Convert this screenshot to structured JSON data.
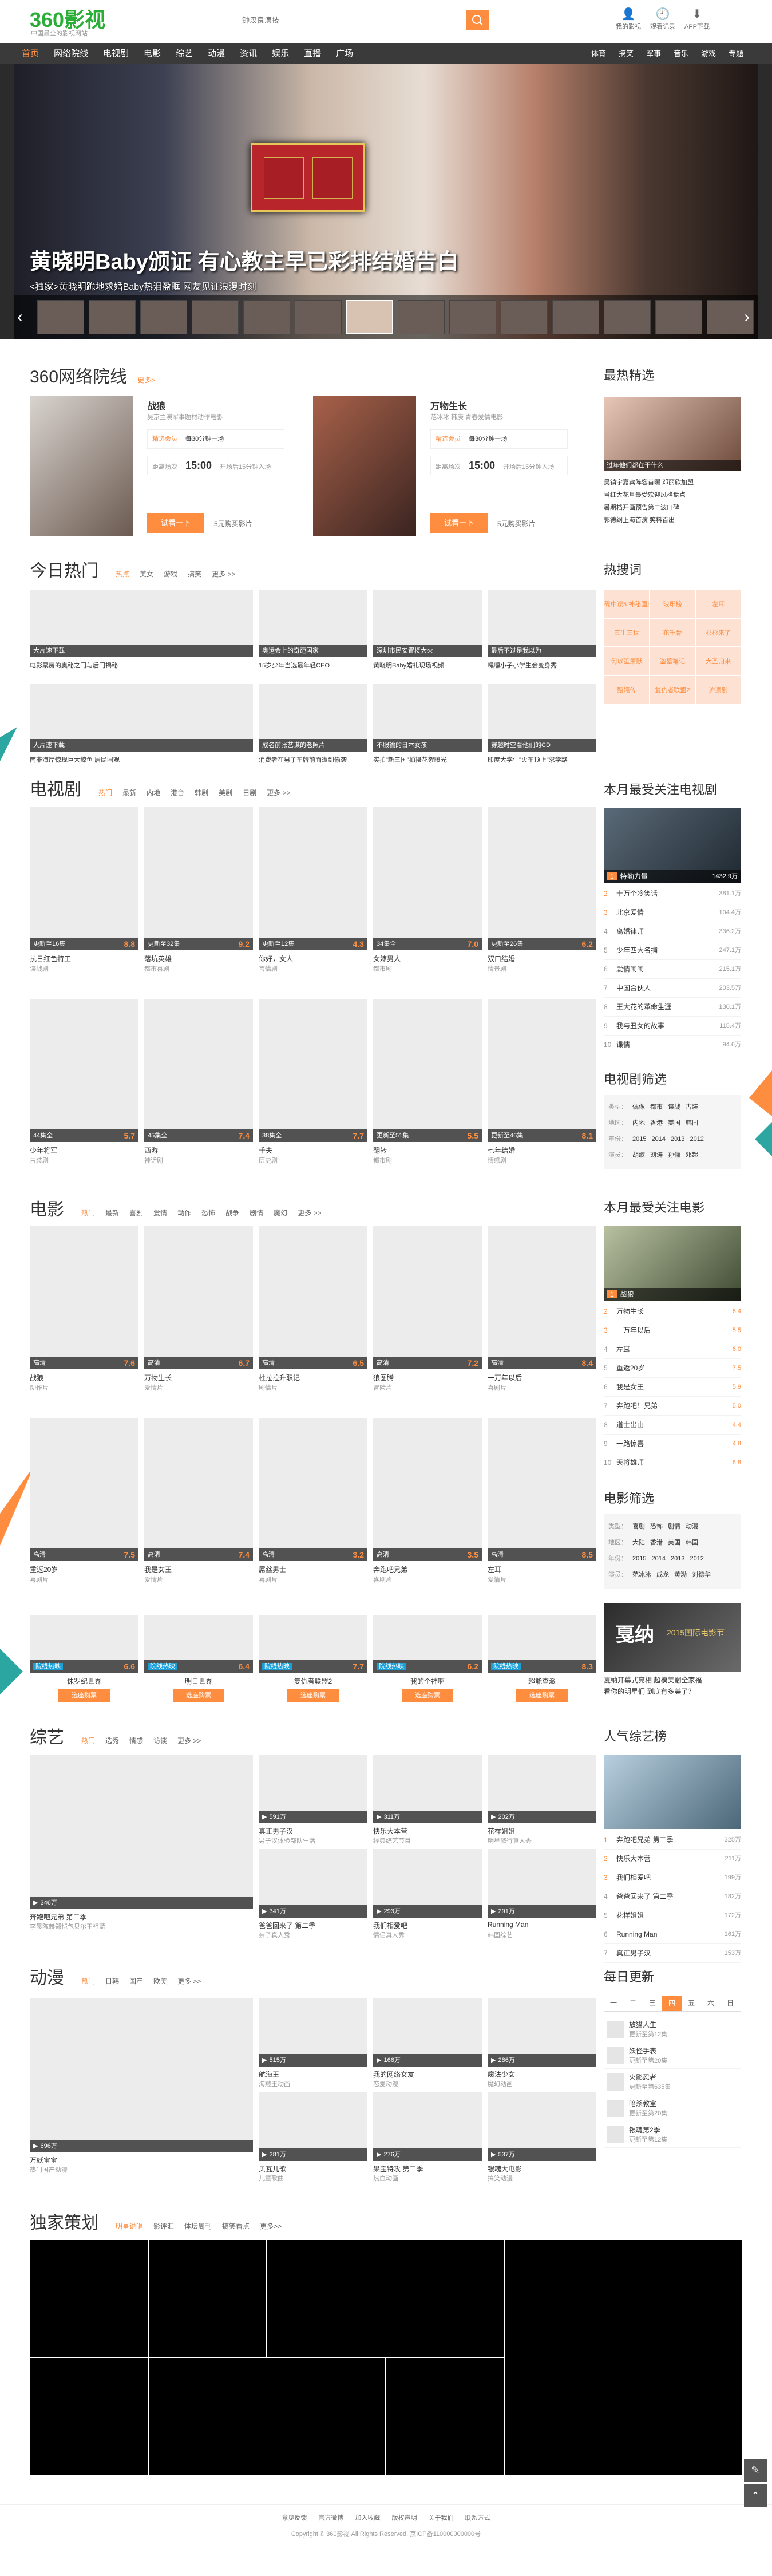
{
  "header": {
    "logo_text": "360影视",
    "logo_slogan": "中国最全的影视网站",
    "search_placeholder": "钟汉良演技",
    "icons": [
      {
        "label": "我的影视",
        "icon": "user-icon"
      },
      {
        "label": "观看记录",
        "icon": "clock-icon"
      },
      {
        "label": "APP下载",
        "icon": "download-icon"
      }
    ]
  },
  "nav": {
    "items": [
      "首页",
      "网络院线",
      "电视剧",
      "电影",
      "综艺",
      "动漫",
      "资讯",
      "娱乐",
      "直播",
      "广场"
    ],
    "right": [
      "体育",
      "搞笑",
      "军事",
      "音乐",
      "游戏",
      "专题"
    ]
  },
  "banner": {
    "headline": "黄晓明Baby颁证 有心教主早已彩排结婚告白",
    "subline": "<独家>黄晓明跪地求婚Baby热泪盈眶 网友见证浪漫时刻"
  },
  "cinema": {
    "title": "360网络院线",
    "more": "更多>",
    "items": [
      {
        "name": "战狼",
        "desc": "吴京主演军事题材动作电影",
        "price_label": "精选会员",
        "price_note": "每30分钟一场",
        "time_label": "距离场次",
        "time": "15:00",
        "time_note": "开场后15分钟入场",
        "btn": "试看一下",
        "buy": "5元购买影片"
      },
      {
        "name": "万物生长",
        "desc": "范冰冰 韩庚 青春爱情电影",
        "price_label": "精选会员",
        "price_note": "每30分钟一场",
        "time_label": "距离场次",
        "time": "15:00",
        "time_note": "开场后15分钟入场",
        "btn": "试看一下",
        "buy": "5元购买影片"
      }
    ]
  },
  "hot_pick": {
    "title": "最热精选",
    "caption": "过年他们都在干什么",
    "items": [
      "吴镇宇嘉宾阵容首曝 邓丽欣加盟",
      "当红大花旦最受欢迎风格盘点",
      "暑期档开画预告第二波口碑",
      "郭德纲上海首演 笑料百出"
    ]
  },
  "today": {
    "title": "今日热门",
    "tabs": [
      "热点",
      "美女",
      "游戏",
      "搞笑",
      "更多 >>"
    ],
    "items": [
      {
        "tag": "大片速下载",
        "title": "电影票房的奥秘之门与后门揭秘"
      },
      {
        "tag": "奥运会上的奇葩国家",
        "title": "15岁少年当选最年轻CEO"
      },
      {
        "tag": "深圳市民安置楼大火",
        "title": "黄晓明Baby婚礼现场视频"
      },
      {
        "tag": "最后不过是我以为",
        "title": "嘿嘿小子小学生会变身秀"
      },
      {
        "tag": "大片速下载",
        "title": "南非海岸惊现巨大鲸鱼 居民围观"
      },
      {
        "tag": "成名前张艺谋的老照片",
        "title": "消费者在男子车牌前面遭到偷袭"
      },
      {
        "tag": "不服输的日本女孩",
        "title": "实拍\"新三国\"拍摄花絮曝光"
      },
      {
        "tag": "穿越时空看他们的CD",
        "title": "印度大学生\"火车顶上\"求学路"
      }
    ]
  },
  "hot_search": {
    "title": "热搜词",
    "words": [
      "碟中谍5:神秘国度",
      "琅琊榜",
      "左耳",
      "三生三世",
      "花千骨",
      "杉杉来了",
      "何以笙箫默",
      "盗墓笔记",
      "大圣归来",
      "甄嬛传",
      "复仇者联盟2",
      "沪漂剧"
    ]
  },
  "tv": {
    "title": "电视剧",
    "tabs": [
      "热门",
      "最新",
      "内地",
      "港台",
      "韩剧",
      "美剧",
      "日剧",
      "更多 >>"
    ],
    "items": [
      {
        "ep": "更新至16集",
        "score": "8.8",
        "title": "抗日红色特工",
        "sub": "谍战剧"
      },
      {
        "ep": "更新至32集",
        "score": "9.2",
        "title": "落坑英雄",
        "sub": "都市喜剧"
      },
      {
        "ep": "更新至12集",
        "score": "4.3",
        "title": "你好，女人",
        "sub": "言情剧"
      },
      {
        "ep": "34集全",
        "score": "7.0",
        "title": "女嫁男人",
        "sub": "都市剧"
      },
      {
        "ep": "更新至26集",
        "score": "6.2",
        "title": "双口结婚",
        "sub": "情景剧"
      },
      {
        "ep": "44集全",
        "score": "5.7",
        "title": "少年将军",
        "sub": "古装剧"
      },
      {
        "ep": "45集全",
        "score": "7.4",
        "title": "西游",
        "sub": "神话剧"
      },
      {
        "ep": "38集全",
        "score": "7.7",
        "title": "千夫",
        "sub": "历史剧"
      },
      {
        "ep": "更新至51集",
        "score": "5.5",
        "title": "翻转",
        "sub": "都市剧"
      },
      {
        "ep": "更新至46集",
        "score": "8.1",
        "title": "七年结婚",
        "sub": "情感剧"
      }
    ]
  },
  "tv_rank": {
    "title": "本月最受关注电视剧",
    "top_name": "特勤力量",
    "top_count": "1432.9万",
    "items": [
      {
        "n": "2",
        "name": "十万个冷笑话",
        "count": "381.1万"
      },
      {
        "n": "3",
        "name": "北京爱情",
        "count": "104.4万"
      },
      {
        "n": "4",
        "name": "离婚律师",
        "count": "336.2万"
      },
      {
        "n": "5",
        "name": "少年四大名捕",
        "count": "247.1万"
      },
      {
        "n": "6",
        "name": "爱情闹闹",
        "count": "215.1万"
      },
      {
        "n": "7",
        "name": "中国合伙人",
        "count": "203.5万"
      },
      {
        "n": "8",
        "name": "王大花的革命生涯",
        "count": "130.1万"
      },
      {
        "n": "9",
        "name": "我与丑女的故事",
        "count": "115.4万"
      },
      {
        "n": "10",
        "name": "谍情",
        "count": "94.6万"
      }
    ]
  },
  "tv_filter": {
    "title": "电视剧筛选",
    "rows": [
      [
        "类型：",
        "偶像",
        "都市",
        "谍战",
        "古装"
      ],
      [
        "地区：",
        "内地",
        "香港",
        "美国",
        "韩国"
      ],
      [
        "年份：",
        "2015",
        "2014",
        "2013",
        "2012"
      ],
      [
        "演员：",
        "胡歌",
        "刘涛",
        "孙俪",
        "邓超"
      ]
    ]
  },
  "movie": {
    "title": "电影",
    "tabs": [
      "热门",
      "最新",
      "喜剧",
      "爱情",
      "动作",
      "恐怖",
      "战争",
      "剧情",
      "魔幻",
      "更多 >>"
    ],
    "items": [
      {
        "q": "高清",
        "score": "7.6",
        "title": "战狼",
        "sub": "动作片"
      },
      {
        "q": "高清",
        "score": "6.7",
        "title": "万物生长",
        "sub": "爱情片"
      },
      {
        "q": "高清",
        "score": "6.5",
        "title": "杜拉拉升职记",
        "sub": "剧情片"
      },
      {
        "q": "高清",
        "score": "7.2",
        "title": "狼图腾",
        "sub": "冒险片"
      },
      {
        "q": "高清",
        "score": "8.4",
        "title": "一万年以后",
        "sub": "喜剧片"
      },
      {
        "q": "高清",
        "score": "7.5",
        "title": "重返20岁",
        "sub": "喜剧片"
      },
      {
        "q": "高清",
        "score": "7.4",
        "title": "我是女王",
        "sub": "爱情片"
      },
      {
        "q": "高清",
        "score": "3.2",
        "title": "屌丝男士",
        "sub": "喜剧片"
      },
      {
        "q": "高清",
        "score": "3.5",
        "title": "奔跑吧兄弟",
        "sub": "喜剧片"
      },
      {
        "q": "高清",
        "score": "8.5",
        "title": "左耳",
        "sub": "爱情片"
      },
      {
        "tag": "院线热映",
        "score": "6.6",
        "title": "侏罗纪世界",
        "btn": "选座购票"
      },
      {
        "tag": "院线热映",
        "score": "6.4",
        "title": "明日世界",
        "btn": "选座购票"
      },
      {
        "tag": "院线热映",
        "score": "7.7",
        "title": "复仇者联盟2",
        "btn": "选座购票"
      },
      {
        "tag": "院线热映",
        "score": "6.2",
        "title": "我的个神啊",
        "btn": "选座购票"
      },
      {
        "tag": "院线热映",
        "score": "8.3",
        "title": "超能查派",
        "btn": "选座购票"
      }
    ]
  },
  "movie_rank": {
    "title": "本月最受关注电影",
    "top_name": "战狼",
    "items": [
      {
        "n": "2",
        "name": "万物生长",
        "score": "6.4"
      },
      {
        "n": "3",
        "name": "一万年以后",
        "score": "5.5"
      },
      {
        "n": "4",
        "name": "左耳",
        "score": "6.0"
      },
      {
        "n": "5",
        "name": "重返20岁",
        "score": "7.5"
      },
      {
        "n": "6",
        "name": "我是女王",
        "score": "5.9"
      },
      {
        "n": "7",
        "name": "奔跑吧！兄弟",
        "score": "5.0"
      },
      {
        "n": "8",
        "name": "道士出山",
        "score": "4.4"
      },
      {
        "n": "9",
        "name": "一路惊喜",
        "score": "4.8"
      },
      {
        "n": "10",
        "name": "天将雄师",
        "score": "6.8"
      }
    ]
  },
  "movie_filter": {
    "title": "电影筛选",
    "rows": [
      [
        "类型：",
        "喜剧",
        "恐怖",
        "剧情",
        "动漫"
      ],
      [
        "地区：",
        "大陆",
        "香港",
        "美国",
        "韩国"
      ],
      [
        "年份：",
        "2015",
        "2014",
        "2013",
        "2012"
      ],
      [
        "演员：",
        "范冰冰",
        "成龙",
        "黄渤",
        "刘德华"
      ]
    ]
  },
  "ad": {
    "title": "戛纳",
    "subtitle": "2015国际电影节",
    "caption": "戛纳开幕式亮相 超模美翻全家福",
    "caption2": "看你的明星们 到底有多美了？"
  },
  "variety": {
    "title": "综艺",
    "tabs": [
      "热门",
      "选秀",
      "情感",
      "访谈",
      "更多 >>"
    ],
    "items": [
      {
        "cnt": "346万",
        "title": "奔跑吧兄弟 第二季",
        "sub": "李晨陈赫郑恺包贝尔王祖蓝"
      },
      {
        "cnt": "591万",
        "title": "真正男子汉",
        "sub": "男子汉体验部队生活"
      },
      {
        "cnt": "311万",
        "title": "快乐大本营",
        "sub": "经典综艺节目"
      },
      {
        "cnt": "202万",
        "title": "花样姐姐",
        "sub": "明星旅行真人秀"
      },
      {
        "cnt": "341万",
        "title": "爸爸回来了 第二季",
        "sub": "亲子真人秀"
      },
      {
        "cnt": "293万",
        "title": "我们相爱吧",
        "sub": "情侣真人秀"
      },
      {
        "cnt": "291万",
        "title": "Running Man",
        "sub": "韩国综艺"
      }
    ]
  },
  "variety_rank": {
    "title": "人气综艺榜",
    "items": [
      {
        "n": "1",
        "name": "奔跑吧兄弟 第二季",
        "count": "325万"
      },
      {
        "n": "2",
        "name": "快乐大本营",
        "count": "211万"
      },
      {
        "n": "3",
        "name": "我们相爱吧",
        "count": "199万"
      },
      {
        "n": "4",
        "name": "爸爸回来了 第二季",
        "count": "182万"
      },
      {
        "n": "5",
        "name": "花样姐姐",
        "count": "172万"
      },
      {
        "n": "6",
        "name": "Running Man",
        "count": "161万"
      },
      {
        "n": "7",
        "name": "真正男子汉",
        "count": "153万"
      }
    ]
  },
  "anime": {
    "title": "动漫",
    "tabs": [
      "热门",
      "日韩",
      "国产",
      "欧美",
      "更多 >>"
    ],
    "items": [
      {
        "cnt": "696万",
        "title": "万妖宝宝",
        "sub": "热门国产动漫"
      },
      {
        "cnt": "515万",
        "title": "航海王",
        "sub": "海贼王动画"
      },
      {
        "cnt": "166万",
        "title": "我的网络女友",
        "sub": "恋爱动漫"
      },
      {
        "cnt": "286万",
        "title": "魔法少女",
        "sub": "魔幻动画"
      },
      {
        "cnt": "281万",
        "title": "贝瓦儿歌",
        "sub": "儿童歌曲"
      },
      {
        "cnt": "276万",
        "title": "果宝特攻 第二季",
        "sub": "热血动画"
      },
      {
        "cnt": "537万",
        "title": "银魂大电影",
        "sub": "搞笑动漫"
      }
    ]
  },
  "daily": {
    "title": "每日更新",
    "days": [
      "一",
      "二",
      "三",
      "四",
      "五",
      "六",
      "日"
    ],
    "active": "四",
    "items": [
      {
        "name": "放猫人生",
        "ep": "更新至第12集"
      },
      {
        "name": "妖怪手表",
        "ep": "更新至第20集"
      },
      {
        "name": "火影忍者",
        "ep": "更新至第635集"
      },
      {
        "name": "暗杀教室",
        "ep": "更新至第20集"
      },
      {
        "name": "银魂第2季",
        "ep": "更新至第12集"
      }
    ]
  },
  "exclusive": {
    "title": "独家策划",
    "tabs": [
      "明星说唱",
      "影评汇",
      "体坛周刊",
      "搞笑看点",
      "更多>>"
    ]
  },
  "footer": {
    "links": [
      "意见反馈",
      "官方微博",
      "加入收藏",
      "版权声明",
      "关于我们",
      "联系方式"
    ],
    "copyright": "Copyright © 360影视 All Rights Reserved.  京ICP备110000000000号"
  },
  "colors": {
    "accent": "#ff8d3f",
    "nav": "#3a3a3a",
    "logo_green": "#2bae37"
  }
}
